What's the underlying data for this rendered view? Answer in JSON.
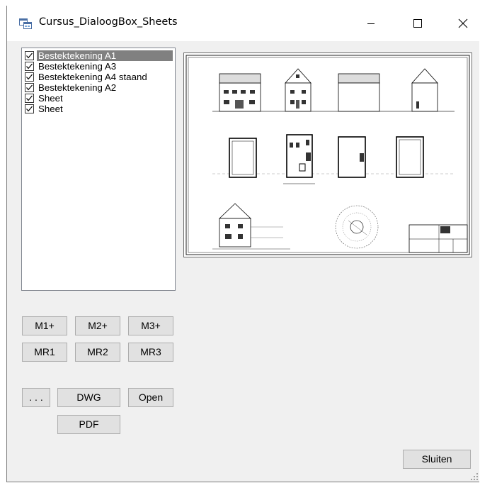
{
  "window": {
    "title": "Cursus_DialoogBox_Sheets",
    "icons": {
      "app": "app-form-icon",
      "minimize": "minimize-icon",
      "maximize": "maximize-icon",
      "close": "close-icon"
    }
  },
  "sheets": {
    "items": [
      {
        "label": "Bestektekening A1",
        "checked": true,
        "selected": true
      },
      {
        "label": "Bestektekening A3",
        "checked": true,
        "selected": false
      },
      {
        "label": "Bestektekening A4 staand",
        "checked": true,
        "selected": false
      },
      {
        "label": "Bestektekening A2",
        "checked": true,
        "selected": false
      },
      {
        "label": "Sheet",
        "checked": true,
        "selected": false
      },
      {
        "label": "Sheet",
        "checked": true,
        "selected": false
      }
    ]
  },
  "buttons": {
    "m1_plus": "M1+",
    "m2_plus": "M2+",
    "m3_plus": "M3+",
    "mr1": "MR1",
    "mr2": "MR2",
    "mr3": "MR3",
    "browse": ". . .",
    "dwg": "DWG",
    "open": "Open",
    "pdf": "PDF",
    "close": "Sluiten"
  },
  "colors": {
    "window_bg": "#f0f0f0",
    "selection_bg": "#808080",
    "button_bg": "#e1e1e1",
    "button_border": "#adadad"
  }
}
